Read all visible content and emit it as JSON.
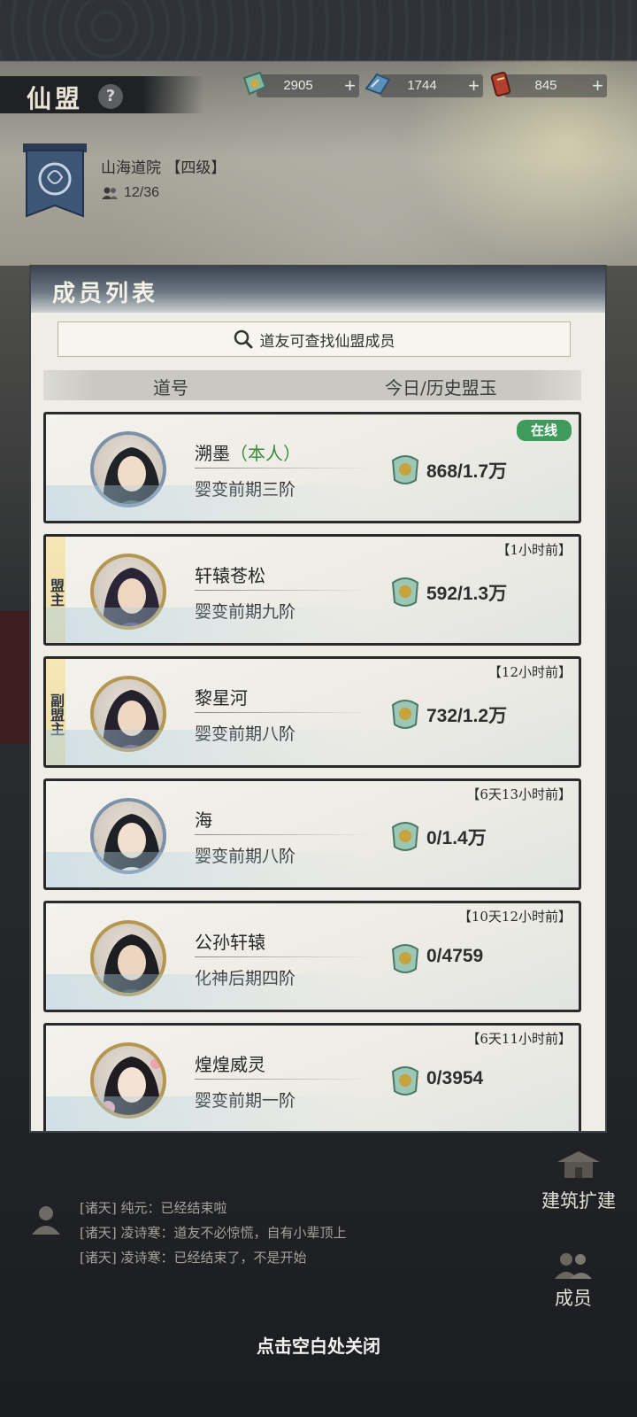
{
  "header": {
    "title": "仙盟",
    "help_label": "?"
  },
  "currencies": [
    {
      "icon": "jade-stone-icon",
      "value": "2905",
      "plus": "+"
    },
    {
      "icon": "spirit-crystal-icon",
      "value": "1744",
      "plus": "+"
    },
    {
      "icon": "scroll-token-icon",
      "value": "845",
      "plus": "+"
    }
  ],
  "sect": {
    "name": "山海道院 【四级】",
    "members": "12/36"
  },
  "panel": {
    "title": "成员列表",
    "search_placeholder": "道友可查找仙盟成员",
    "col_name": "道号",
    "col_score": "今日/历史盟玉"
  },
  "members": [
    {
      "name": "溯墨",
      "self_tag": "（本人）",
      "realm": "婴变前期三阶",
      "score": "868/1.7万",
      "status": "在线",
      "role": ""
    },
    {
      "name": "轩辕苍松",
      "self_tag": "",
      "realm": "婴变前期九阶",
      "score": "592/1.3万",
      "status": "【1小时前】",
      "role": "盟主"
    },
    {
      "name": "黎星河",
      "self_tag": "",
      "realm": "婴变前期八阶",
      "score": "732/1.2万",
      "status": "【12小时前】",
      "role": "副盟主"
    },
    {
      "name": "海",
      "self_tag": "",
      "realm": "婴变前期八阶",
      "score": "0/1.4万",
      "status": "【6天13小时前】",
      "role": ""
    },
    {
      "name": "公孙轩辕",
      "self_tag": "",
      "realm": "化神后期四阶",
      "score": "0/4759",
      "status": "【10天12小时前】",
      "role": ""
    },
    {
      "name": "煌煌威灵",
      "self_tag": "",
      "realm": "婴变前期一阶",
      "score": "0/3954",
      "status": "【6天11小时前】",
      "role": ""
    }
  ],
  "chat": [
    "[诸天] 纯元：已经结束啦",
    "[诸天] 凌诗寒：道友不必惊慌，自有小辈顶上",
    "[诸天] 凌诗寒：已经结束了，不是开始"
  ],
  "side_buttons": {
    "build": "建筑扩建",
    "members": "成员"
  },
  "close_hint": "点击空白处关闭",
  "colors": {
    "online": "#3f9b5c",
    "self_tag": "#3c8a3e",
    "role_tag": "#f6e7b8"
  }
}
